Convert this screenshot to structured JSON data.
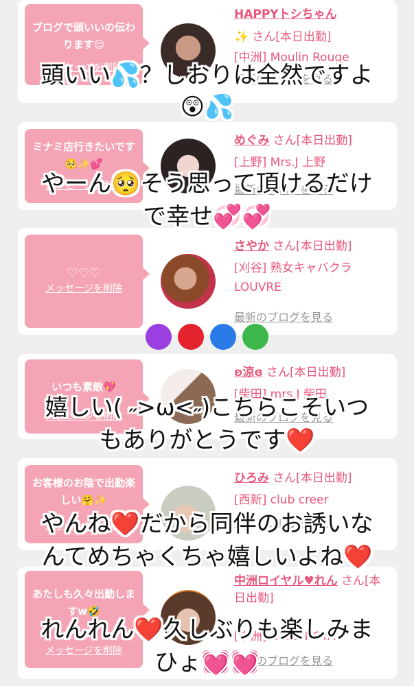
{
  "cards": [
    {
      "bubble": "ブログで頭いいの伝わります😌",
      "delete_label": "メッセージを削除",
      "name": "HAPPYトシちゃん",
      "sparkle": "✨",
      "status": "さん[本日出勤]",
      "shop": "[中洲] Moulin Rouge",
      "blog_link": "最新のブログを見る"
    },
    {
      "bubble": "ミナミ店行きたいです🥺✨💕",
      "delete_label": "メッセージを削除",
      "name": "めぐみ",
      "status": "さん[本日出勤]",
      "shop": "[上野] Mrs.J 上野",
      "blog_link": "最新のブログを見る"
    },
    {
      "bubble": "♡♡♡",
      "delete_label": "メッセージを削除",
      "name": "さやか",
      "status": "さん[本日出勤]",
      "shop": "[刈谷] 熟女キャバクラ LOUVRE",
      "blog_link": "最新のブログを見る"
    },
    {
      "bubble": "いつも素敵💖",
      "delete_label": "メッセージを削除",
      "name": "ʚ涼ɞ",
      "status": "さん[本日出勤]",
      "shop": "[柴田] mrs.J 柴田",
      "blog_link": "最新のブログを見る"
    },
    {
      "bubble": "お客様のお陰で出勤楽しい🤗✨",
      "delete_label": "メッセージを削除",
      "name": "ひろみ",
      "status": "さん[本日出勤]",
      "shop": "[西新] club creer",
      "blog_link": "最新のブログを見る"
    },
    {
      "bubble": "あたしも久々出勤しますw🤣",
      "delete_label": "メッセージを削除",
      "name": "中洲ロイヤル♥れん",
      "status": "さん[本日出勤]",
      "shop": "[中洲] CLUB ROYAL",
      "blog_link": "最新のブログを見る"
    }
  ],
  "captions": [
    "頭いい💦？しおりは全然ですよ",
    "😲💦",
    "やーん🥺そう思って頂けるだけ",
    "で幸せ💞💞",
    "嬉しい(  ˶>ω<˶)こちらこそいつ",
    "もありがとうです❤️",
    "やんね❤️だから同伴のお誘いな",
    "んてめちゃくちゃ嬉しいよね❤️",
    "れんれん❤️久しぶりも楽しみま",
    "ひょ💓💓"
  ],
  "hearts": {
    "icons": [
      "purple-heart",
      "red-heart",
      "blue-heart",
      "green-heart"
    ],
    "colors": [
      "#9b3fe0",
      "#e4232f",
      "#2a7ae8",
      "#3cb84a"
    ]
  }
}
